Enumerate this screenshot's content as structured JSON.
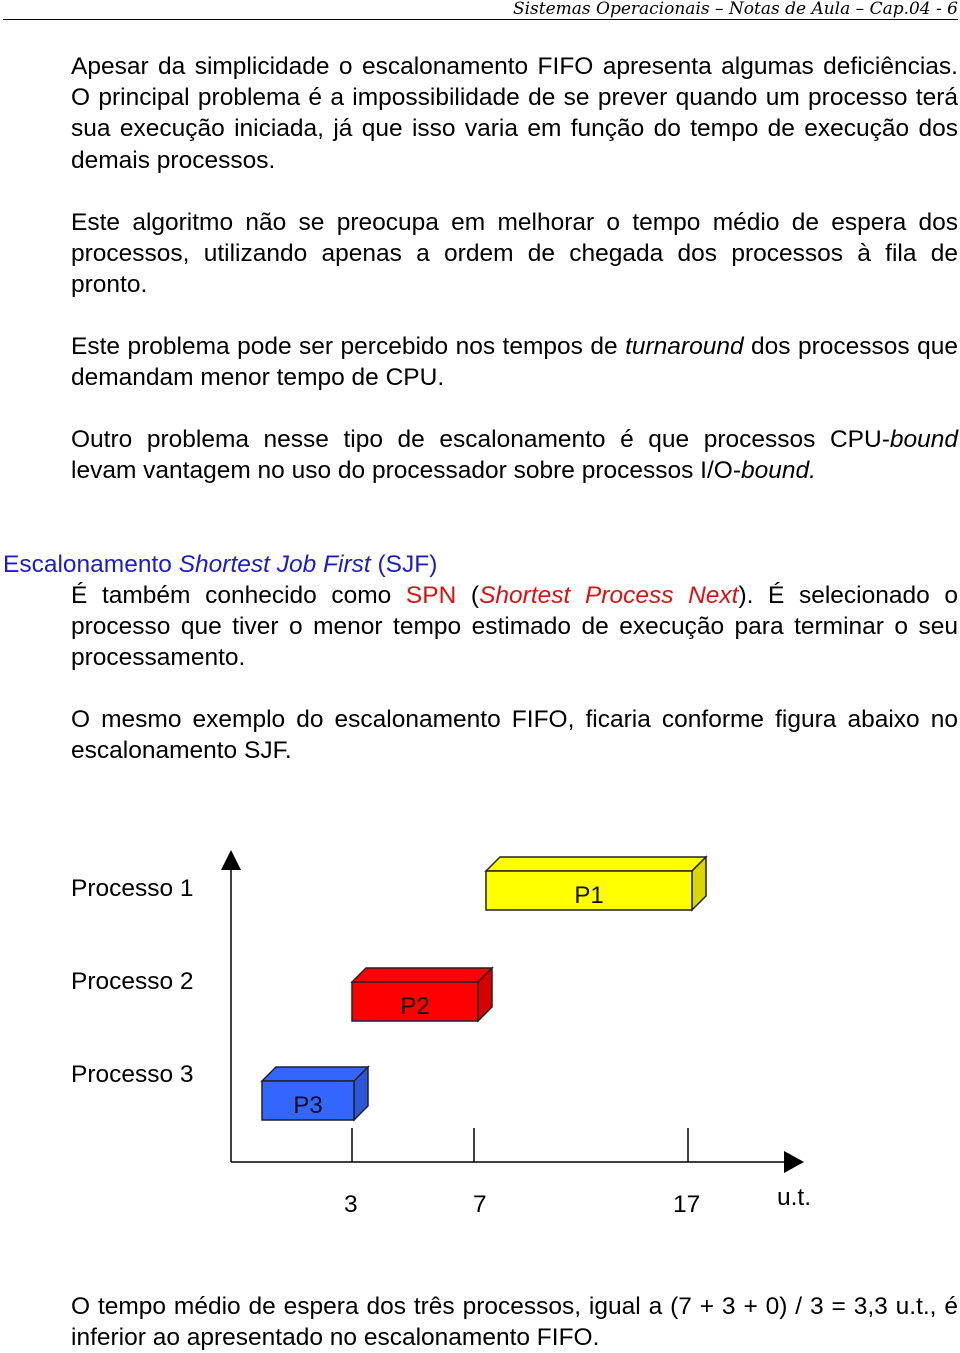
{
  "header": {
    "running_title": "Sistemas Operacionais – Notas de Aula – Cap.04 - 6"
  },
  "paragraphs": {
    "p1": "Apesar da simplicidade o escalonamento FIFO apresenta algumas deficiências. O principal problema é a impossibilidade de se prever quando um processo terá sua execução iniciada, já que isso varia em função do tempo de execução dos demais processos.",
    "p2": "Este algoritmo não se preocupa em melhorar o tempo médio de espera dos processos, utilizando apenas a ordem de chegada dos processos à fila de pronto.",
    "p3a": "Este problema pode ser percebido nos tempos de ",
    "p3b": "turnaround",
    "p3c": " dos processos que demandam menor tempo de CPU.",
    "p4a": "Outro problema nesse tipo de escalonamento é que processos CPU-",
    "p4b": "bound",
    "p4c": " levam vantagem no uso do processador sobre processos I/O-",
    "p4d": "bound."
  },
  "section": {
    "heading_a": "Escalonamento ",
    "heading_b": "Shortest Job First",
    "heading_c": " (SJF)",
    "p5a": "É também conhecido como ",
    "p5b": "SPN",
    "p5c": " (",
    "p5d": "Shortest Process Next",
    "p5e": "). É selecionado o processo que tiver o menor tempo estimado de execução para terminar o seu processamento.",
    "p6": "O mesmo exemplo do escalonamento FIFO, ficaria conforme figura abaixo no escalonamento SJF."
  },
  "diagram": {
    "rows": [
      "Processo 1",
      "Processo 2",
      "Processo 3"
    ],
    "bars": [
      {
        "label": "P1",
        "start": 7,
        "end": 17,
        "color": "#ffff00"
      },
      {
        "label": "P2",
        "start": 3,
        "end": 7,
        "color": "#ff0000"
      },
      {
        "label": "P3",
        "start": 0,
        "end": 3,
        "color": "#3366ff"
      }
    ],
    "ticks": [
      "3",
      "7",
      "17"
    ],
    "unit": "u.t."
  },
  "footer_paragraph": "O tempo médio de espera dos três processos, igual a (7 + 3 + 0) / 3 = 3,3 u.t., é inferior ao apresentado no escalonamento FIFO."
}
